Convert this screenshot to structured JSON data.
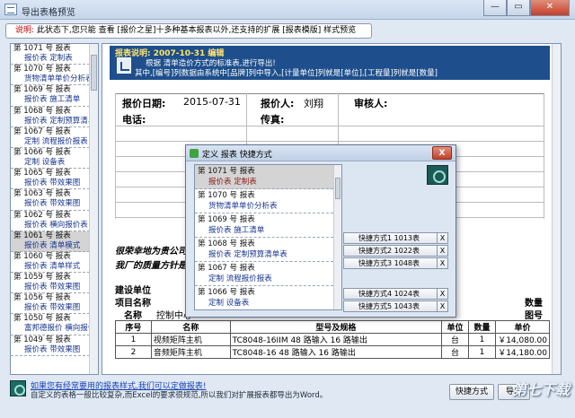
{
  "window": {
    "title": "导出表格预览",
    "minimize": "—",
    "maximize": "▭",
    "close": "✕"
  },
  "hint": {
    "label": "说明:",
    "text": "此状态下,您只能 查看 [报价之星]十多种基本报表以外,还支持的扩展 [报表模版] 样式预览"
  },
  "report_list": [
    {
      "num": "第 1071 号 报表",
      "name": "报价表 定制表"
    },
    {
      "num": "第 1070 号 报表",
      "name": "货物清单单价分析表"
    },
    {
      "num": "第 1069 号 报表",
      "name": "报价表 施工清单"
    },
    {
      "num": "第 1068 号 报表",
      "name": "报价表 定制预算清单表"
    },
    {
      "num": "第 1067 号 报表",
      "name": "定制 流程报价报表"
    },
    {
      "num": "第 1066 号 报表",
      "name": "定制 设备表"
    },
    {
      "num": "第 1065 号 报表",
      "name": "报价表 带效果图"
    },
    {
      "num": "第 1063 号 报表",
      "name": "报价表 带效果图"
    },
    {
      "num": "第 1062 号 报表",
      "name": "报价表 横向报价表"
    },
    {
      "num": "第 1061 号 报表",
      "name": "报价表 清单模式"
    },
    {
      "num": "第 1060 号 报表",
      "name": "报价表 清单样式"
    },
    {
      "num": "第 1059 号 报表",
      "name": "报价表 带效果图"
    },
    {
      "num": "第 1056 号 报表",
      "name": "报价表 带效果图"
    },
    {
      "num": "第 1050 号 报表",
      "name": "富邦德报价 横向报价表"
    },
    {
      "num": "第 1049 号 报表",
      "name": "报价表 带效果图"
    }
  ],
  "report": {
    "caption": "报表说明:    2007-10-31 编辑",
    "desc1": "根据 清单造价方式的标准表,进行导出!",
    "desc2": "其中,[编号]列数据由系统中[品牌]列中导入,[计量单位]列就是[单位],[工程量]列就是[数量]",
    "date_label": "报价日期:",
    "date_value": "2015-07-31",
    "quoter_label": "报价人:",
    "quoter_value": "刘翔",
    "reviewer_label": "审核人:",
    "phone_label": "电话:",
    "fax_label": "传真:",
    "slogan1": "很荣幸地为贵公司提",
    "slogan2": "我厂的质量方针是",
    "unit_label": "建设单位",
    "project_label": "项目名称",
    "qty_header": "数量",
    "drawing_label": "图号",
    "name_label": "名称",
    "control_label": "控制中心"
  },
  "items_table": {
    "headers": [
      "序号",
      "名称",
      "型号及规格",
      "单位",
      "数量",
      "单价"
    ],
    "rows": [
      [
        "1",
        "视频矩阵主机",
        "TC8048-16IIM 48 路输入 16 路输出",
        "台",
        "1",
        "￥14,080.00"
      ],
      [
        "2",
        "音频矩阵主机",
        "TC8048-16 48 路输入 16 路输出",
        "台",
        "1",
        "￥14,180.00"
      ]
    ]
  },
  "dialog": {
    "title": "定义 报表 快捷方式",
    "close": "X",
    "list": [
      {
        "num": "第 1071 号 报表",
        "name": "报价表 定制表"
      },
      {
        "num": "第 1070 号 报表",
        "name": "货物清单单价分析表"
      },
      {
        "num": "第 1069 号 报表",
        "name": "报价表 施工清单"
      },
      {
        "num": "第 1068 号 报表",
        "name": "报价表 定制预算清单表"
      },
      {
        "num": "第 1067 号 报表",
        "name": "定制 流程报价报表"
      },
      {
        "num": "第 1066 号 报表",
        "name": "定制 设备表"
      }
    ],
    "shortcuts": [
      {
        "label": "快捷方式1",
        "value": "1013表",
        "x": "X"
      },
      {
        "label": "快捷方式2",
        "value": "1022表",
        "x": "X"
      },
      {
        "label": "快捷方式3",
        "value": "1048表",
        "x": "X"
      },
      {
        "label": "快捷方式4",
        "value": "1024表",
        "x": "X"
      },
      {
        "label": "快捷方式5",
        "value": "1043表",
        "x": "X"
      }
    ]
  },
  "bottom": {
    "link": "如果您有经常要用的报表样式,我们可以定做报表!",
    "note": "自定义的表格一般比较复杂,而Excel的要求很规范,所以我们对扩展报表都导出为Word。",
    "shortcut_button": "快捷方式",
    "export_button": "导出",
    "watermark": "第七下载"
  }
}
